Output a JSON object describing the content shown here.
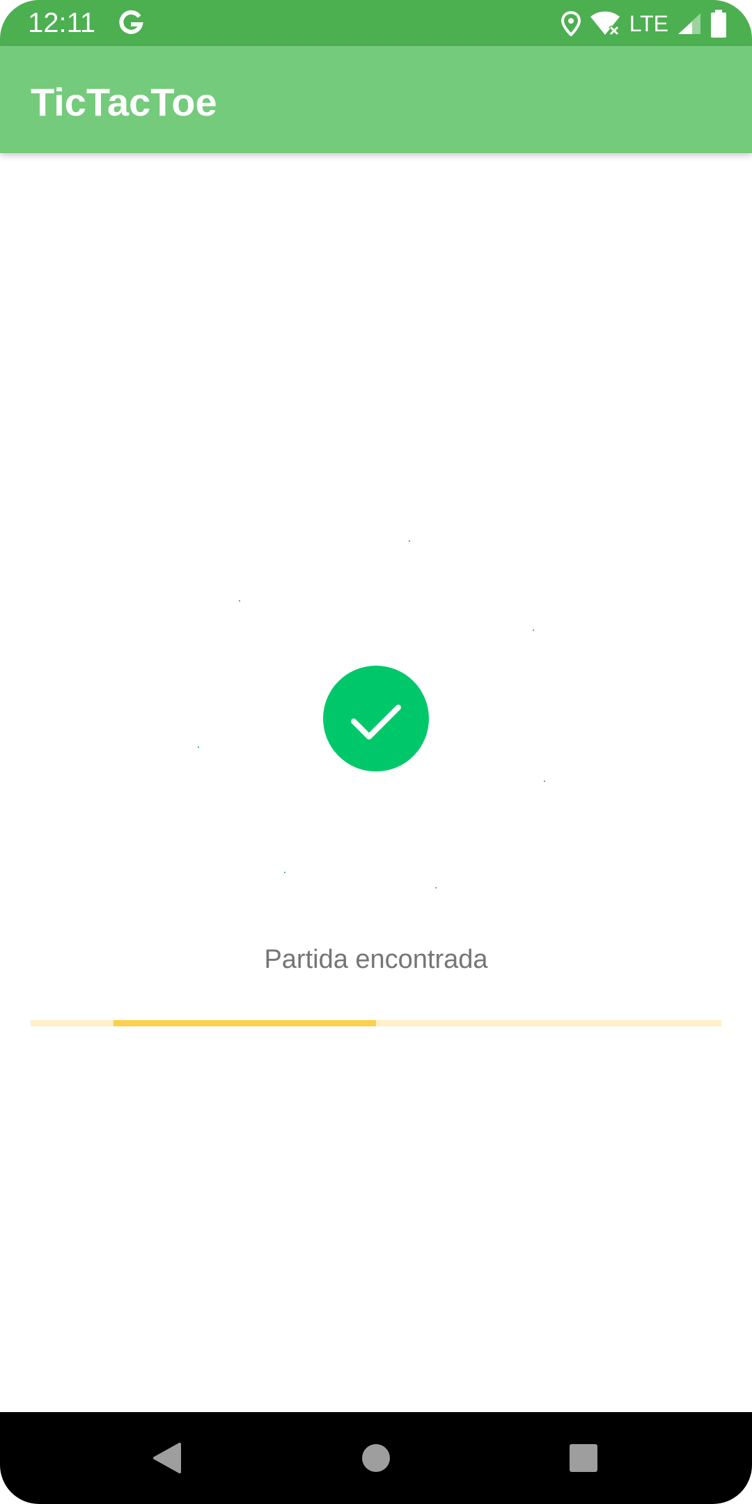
{
  "status_bar": {
    "time": "12:11",
    "network": "LTE",
    "icons": [
      "google-icon",
      "location-icon",
      "wifi-off-icon",
      "signal-icon",
      "battery-icon"
    ]
  },
  "app_bar": {
    "title": "TicTacToe"
  },
  "main": {
    "icon": "checkmark-circle-icon",
    "message": "Partida encontrada",
    "progress": {
      "segment_start_fraction": 0.12,
      "segment_end_fraction": 0.5
    }
  },
  "nav_bar": {
    "icons": [
      "back-icon",
      "home-icon",
      "recents-icon"
    ]
  },
  "colors": {
    "status_bar": "#4caf50",
    "app_bar": "#74cb7b",
    "success": "#00c86a",
    "progress_track": "#fff0c8",
    "progress_fill": "#fccf4d",
    "message_text": "#757575"
  }
}
